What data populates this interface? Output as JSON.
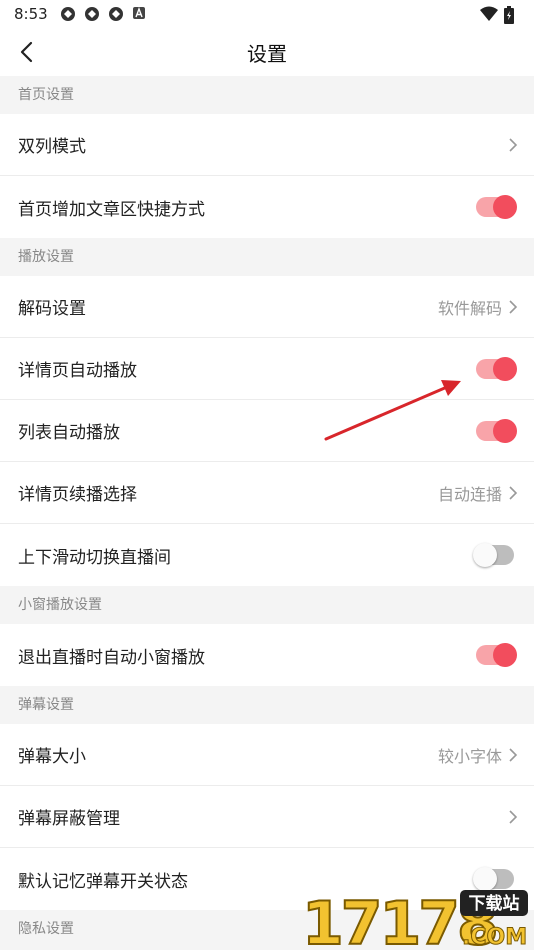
{
  "status_bar": {
    "time": "8:53"
  },
  "header": {
    "title": "设置"
  },
  "sections": {
    "home": {
      "header": "首页设置",
      "double_column": {
        "label": "双列模式"
      },
      "shortcut": {
        "label": "首页增加文章区快捷方式",
        "toggle": "on"
      }
    },
    "play": {
      "header": "播放设置",
      "decoding": {
        "label": "解码设置",
        "value": "软件解码"
      },
      "detail_autoplay": {
        "label": "详情页自动播放",
        "toggle": "on"
      },
      "list_autoplay": {
        "label": "列表自动播放",
        "toggle": "on"
      },
      "continue_play": {
        "label": "详情页续播选择",
        "value": "自动连播"
      },
      "swipe_switch": {
        "label": "上下滑动切换直播间",
        "toggle": "off"
      }
    },
    "mini_window": {
      "header": "小窗播放设置",
      "exit_mini": {
        "label": "退出直播时自动小窗播放",
        "toggle": "on"
      }
    },
    "danmaku": {
      "header": "弹幕设置",
      "size": {
        "label": "弹幕大小",
        "value": "较小字体"
      },
      "block": {
        "label": "弹幕屏蔽管理"
      },
      "remember": {
        "label": "默认记忆弹幕开关状态",
        "toggle": "off"
      }
    },
    "privacy": {
      "header": "隐私设置"
    }
  },
  "watermark": {
    "number": "17178",
    "badge": "下载站",
    "domain": ".COM"
  },
  "colors": {
    "accent": "#f24d5d",
    "accent_track": "#f8a4a9",
    "arrow": "#d8262b"
  }
}
